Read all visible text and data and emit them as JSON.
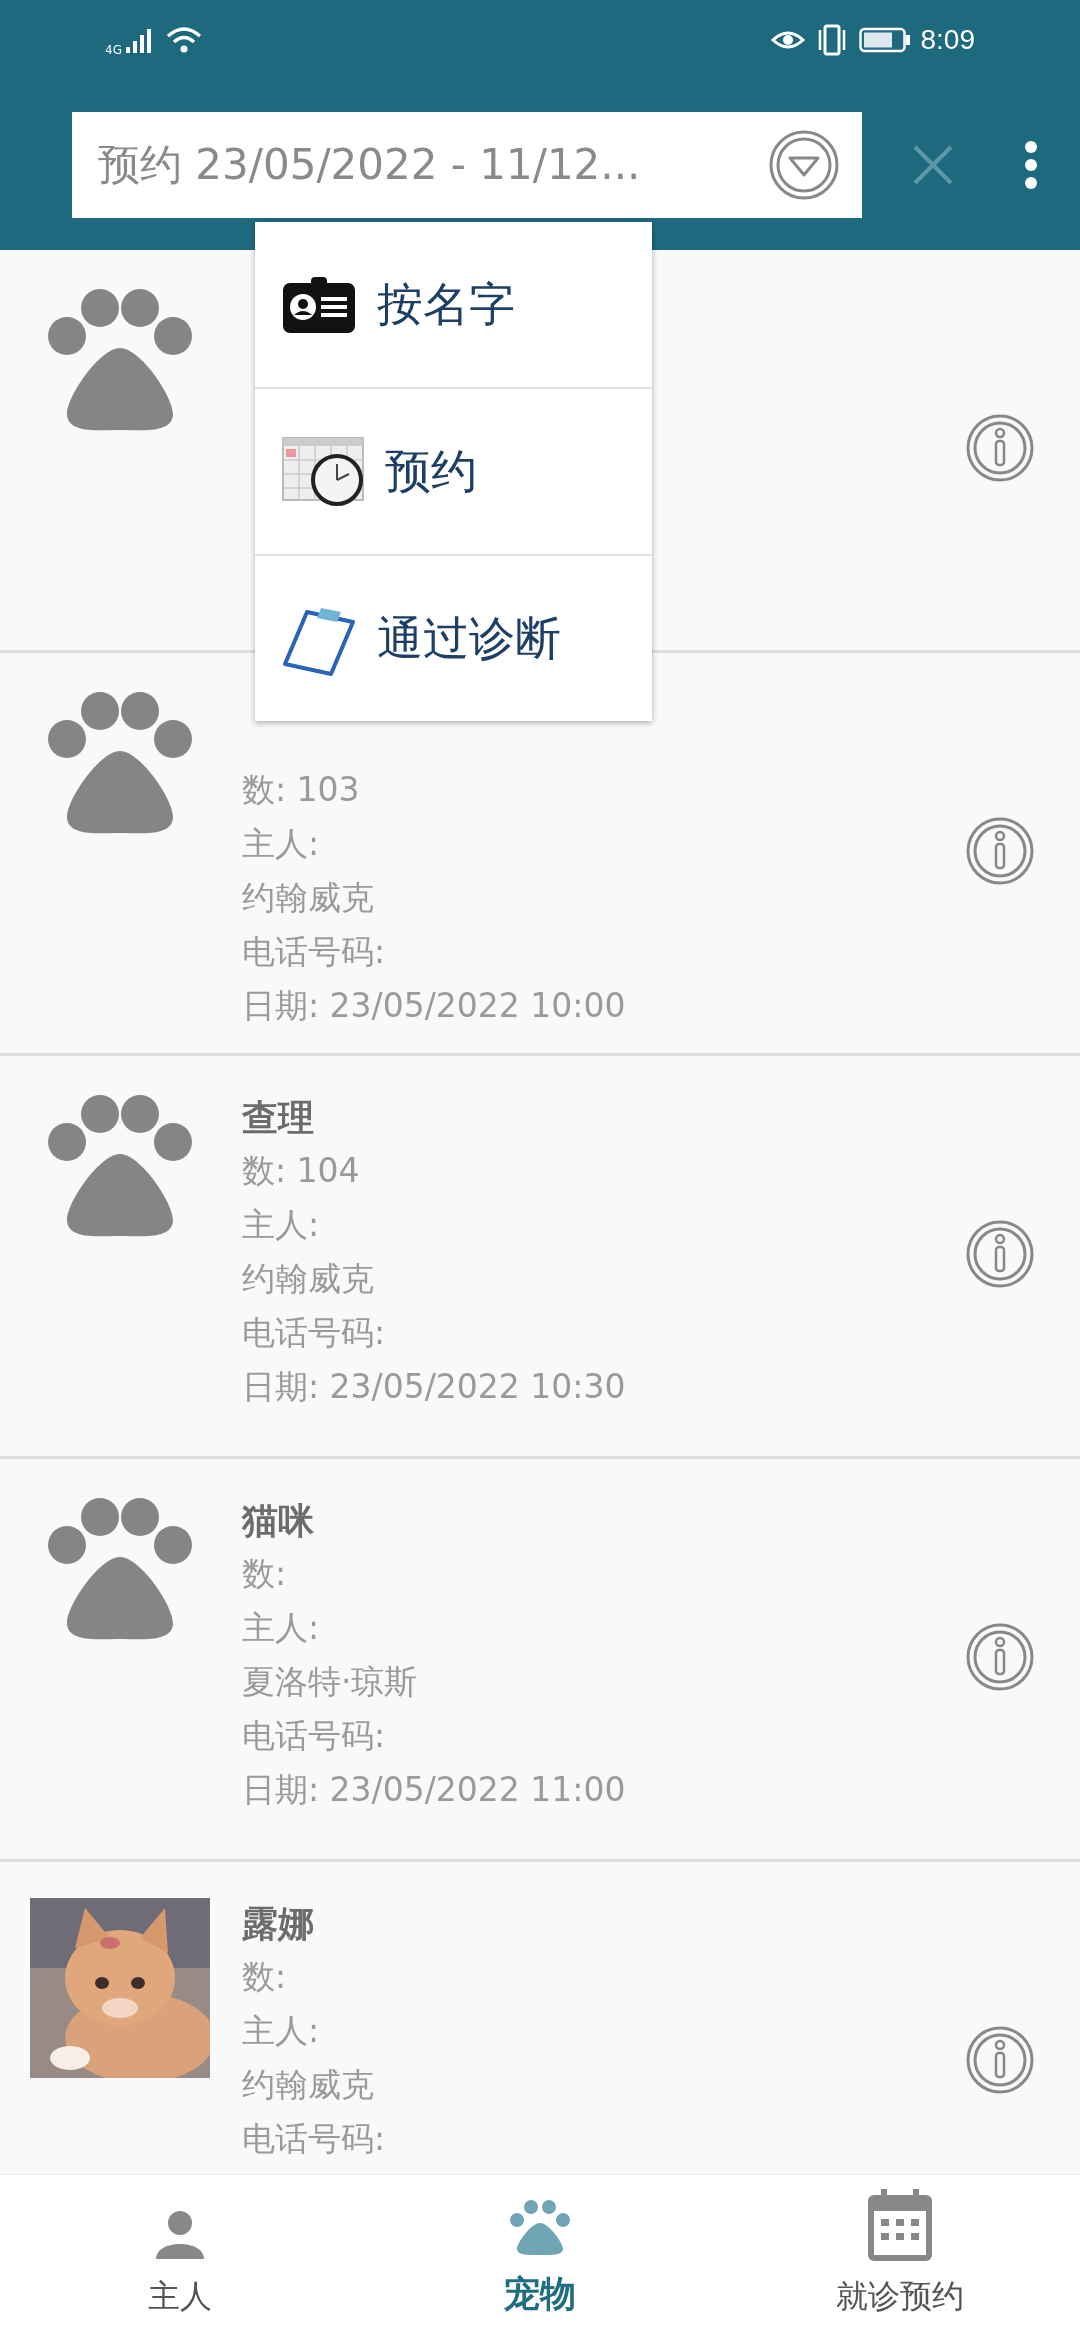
{
  "status_bar": {
    "network": "4G",
    "time": "8:09"
  },
  "search": {
    "value": "预约 23/05/2022 - 11/12..."
  },
  "dropdown_menu": {
    "items": [
      {
        "kind": "badge",
        "label": "按名字"
      },
      {
        "kind": "calendar",
        "label": "预约"
      },
      {
        "kind": "clipboard",
        "label": "通过诊断"
      }
    ]
  },
  "pets": [
    {
      "kind": "paw"
    },
    {
      "kind": "paw",
      "lines": [
        "数: 103",
        "主人:",
        "约翰威克",
        "电话号码:",
        "日期: 23/05/2022 10:00"
      ]
    },
    {
      "kind": "paw",
      "name": "查理",
      "lines": [
        "数: 104",
        "主人:",
        "约翰威克",
        "电话号码:",
        "日期: 23/05/2022 10:30"
      ]
    },
    {
      "kind": "paw",
      "name": "猫咪",
      "lines": [
        "数:",
        "主人:",
        "夏洛特·琼斯",
        "电话号码:",
        "日期: 23/05/2022 11:00"
      ]
    },
    {
      "kind": "picture",
      "name": "露娜",
      "lines": [
        "数:",
        "主人:",
        "约翰威克",
        "电话号码:"
      ]
    }
  ],
  "bottom_nav": [
    {
      "kind": "person",
      "label": "主人",
      "selected": false
    },
    {
      "kind": "paw",
      "label": "宠物",
      "selected": true
    },
    {
      "kind": "calendar",
      "label": "就诊预约",
      "selected": false
    }
  ]
}
